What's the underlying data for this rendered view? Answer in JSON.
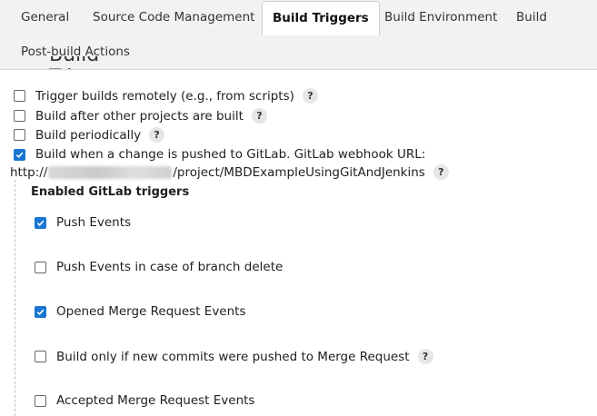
{
  "tabs": [
    {
      "label": "General"
    },
    {
      "label": "Source Code Management"
    },
    {
      "label": "Build Triggers"
    },
    {
      "label": "Build Environment"
    },
    {
      "label": "Build"
    },
    {
      "label": "Post-build Actions"
    }
  ],
  "active_tab": "Build Triggers",
  "heading_partial": "Build Triggers",
  "triggers": [
    {
      "label": "Trigger builds remotely (e.g., from scripts)",
      "checked": false,
      "help": "?"
    },
    {
      "label": "Build after other projects are built",
      "checked": false,
      "help": "?"
    },
    {
      "label": "Build periodically",
      "checked": false,
      "help": "?"
    },
    {
      "label": "Build when a change is pushed to GitLab. GitLab webhook URL:",
      "checked": true
    }
  ],
  "webhook": {
    "prefix": "http://",
    "suffix": "/project/MBDExampleUsingGitAndJenkins",
    "help": "?"
  },
  "gitlab_section_title": "Enabled GitLab triggers",
  "gitlab_triggers": [
    {
      "label": "Push Events",
      "checked": true
    },
    {
      "label": "Push Events in case of branch delete",
      "checked": false
    },
    {
      "label": "Opened Merge Request Events",
      "checked": true
    },
    {
      "label": "Build only if new commits were pushed to Merge Request",
      "checked": false,
      "help": "?"
    },
    {
      "label": "Accepted Merge Request Events",
      "checked": false
    }
  ],
  "colors": {
    "accent": "#1976d2",
    "tabbar_bg": "#f2f2f2"
  }
}
